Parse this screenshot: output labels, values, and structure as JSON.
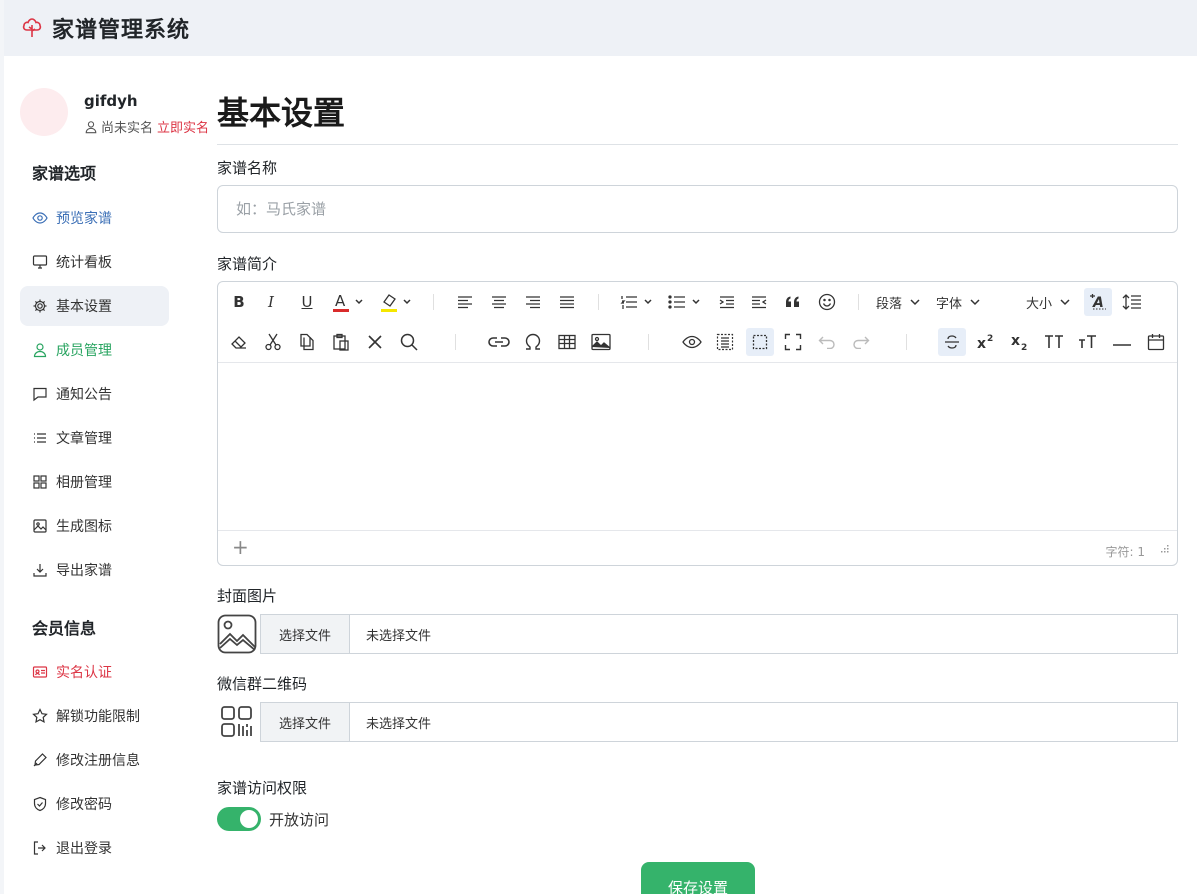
{
  "app": {
    "title": "家谱管理系统"
  },
  "user": {
    "name": "gifdyh",
    "status": "尚未实名",
    "verify_link": "立即实名"
  },
  "sidebar": {
    "section1_title": "家谱选项",
    "section1_items": [
      {
        "label": "预览家谱",
        "icon": "eye-icon"
      },
      {
        "label": "统计看板",
        "icon": "monitor-icon"
      },
      {
        "label": "基本设置",
        "icon": "gear-icon"
      },
      {
        "label": "成员管理",
        "icon": "person-icon"
      },
      {
        "label": "通知公告",
        "icon": "chat-icon"
      },
      {
        "label": "文章管理",
        "icon": "list-icon"
      },
      {
        "label": "相册管理",
        "icon": "grid-icon"
      },
      {
        "label": "生成图标",
        "icon": "image-icon"
      },
      {
        "label": "导出家谱",
        "icon": "download-icon"
      }
    ],
    "section2_title": "会员信息",
    "section2_items": [
      {
        "label": "实名认证",
        "icon": "id-card-icon"
      },
      {
        "label": "解锁功能限制",
        "icon": "star-icon"
      },
      {
        "label": "修改注册信息",
        "icon": "pen-icon"
      },
      {
        "label": "修改密码",
        "icon": "shield-icon"
      },
      {
        "label": "退出登录",
        "icon": "logout-icon"
      }
    ]
  },
  "main": {
    "title": "基本设置",
    "name_label": "家谱名称",
    "name_placeholder": "如：马氏家谱",
    "intro_label": "家谱简介",
    "editor": {
      "paragraph": "段落",
      "font": "字体",
      "size": "大小",
      "word_count": "字符: 1"
    },
    "cover_label": "封面图片",
    "qr_label": "微信群二维码",
    "file_button": "选择文件",
    "file_none": "未选择文件",
    "access_label": "家谱访问权限",
    "access_toggle_label": "开放访问",
    "access_enabled": true,
    "save_button": "保存设置"
  },
  "colors": {
    "accent_green": "#35b36b",
    "danger": "#dc3545",
    "link_blue": "#3b6fb6",
    "topbar_bg": "#eef1f6"
  }
}
